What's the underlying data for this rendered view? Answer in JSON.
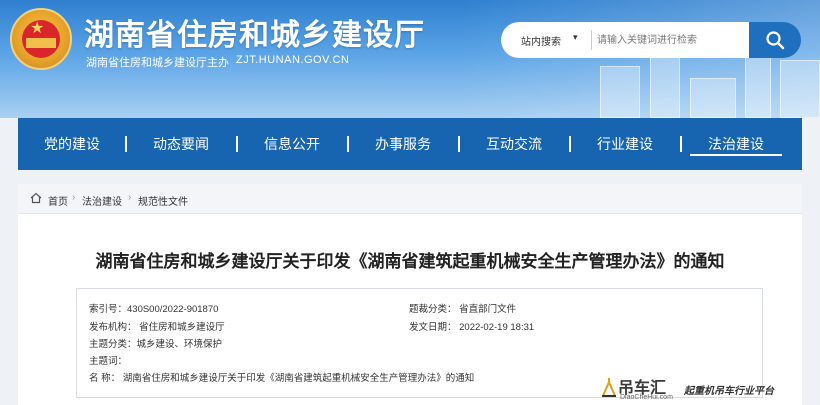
{
  "header": {
    "site_title": "湖南省住房和城乡建设厅",
    "sponsor": "湖南省住房和城乡建设厅主办",
    "url": "ZJT.HUNAN.GOV.CN"
  },
  "search": {
    "scope_label": "站内搜索",
    "placeholder": "请输入关键词进行检索"
  },
  "nav": {
    "items": [
      {
        "label": "党的建设"
      },
      {
        "label": "动态要闻"
      },
      {
        "label": "信息公开"
      },
      {
        "label": "办事服务"
      },
      {
        "label": "互动交流"
      },
      {
        "label": "行业建设"
      },
      {
        "label": "法治建设",
        "active": true
      }
    ]
  },
  "breadcrumb": {
    "items": [
      "首页",
      "法治建设",
      "规范性文件"
    ]
  },
  "article": {
    "title": "湖南省住房和城乡建设厅关于印发《湖南省建筑起重机械安全生产管理办法》的通知"
  },
  "meta": {
    "index_no": "索引号：430S00/2022-901870",
    "publisher": "发布机构：  省住房和城乡建设厅",
    "topic": "主题分类：城乡建设、环境保护",
    "keywords": "主题词：",
    "name": "名    称：  湖南省住房和城乡建设厅关于印发《湖南省建筑起重机械安全生产管理办法》的通知",
    "genre": "题裁分类：  省直部门文件",
    "date": "发文日期：  2022-02-19 18:31"
  },
  "watermark": {
    "brand": "吊车汇",
    "domain": "DiaoCheHui.com",
    "slogan": "起重机吊车行业平台"
  }
}
